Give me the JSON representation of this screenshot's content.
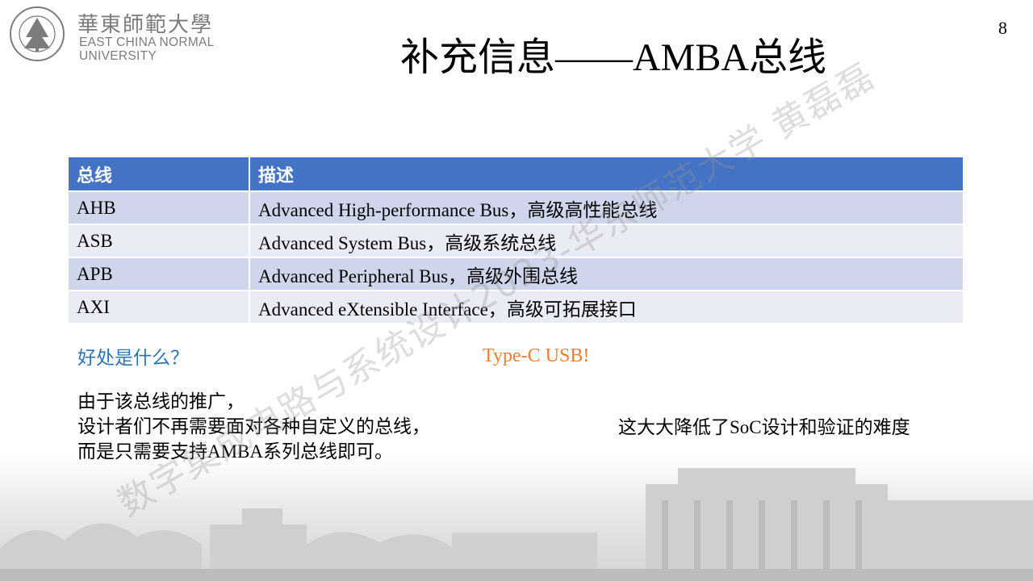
{
  "header": {
    "logo_cn": "華東師範大學",
    "logo_en": "EAST CHINA NORMAL\nUNIVERSITY",
    "page_number": "8"
  },
  "title": "补充信息——AMBA总线",
  "table": {
    "headers": [
      "总线",
      "描述"
    ],
    "rows": [
      {
        "bus": "AHB",
        "desc": "Advanced High-performance Bus，高级高性能总线"
      },
      {
        "bus": "ASB",
        "desc": "Advanced System Bus，高级系统总线"
      },
      {
        "bus": "APB",
        "desc": "Advanced Peripheral Bus，高级外围总线"
      },
      {
        "bus": "AXI",
        "desc": "Advanced eXtensible Interface，高级可拓展接口"
      }
    ]
  },
  "question": "好处是什么？",
  "answer": "Type-C USB!",
  "paragraph": {
    "line1": "由于该总线的推广，",
    "line2": "设计者们不再需要面对各种自定义的总线，",
    "line3": "而是只需要支持AMBA系列总线即可。"
  },
  "conclusion": "这大大降低了SoC设计和验证的难度",
  "watermark": "数字集成电路与系统设计2023-华东师范大学 黄磊磊",
  "colors": {
    "table_header": "#4472c4",
    "row_odd": "#cfd5ea",
    "row_even": "#e9ebf5",
    "question": "#2e75b6",
    "answer": "#ed7d31",
    "logo": "#7c7c7c"
  }
}
